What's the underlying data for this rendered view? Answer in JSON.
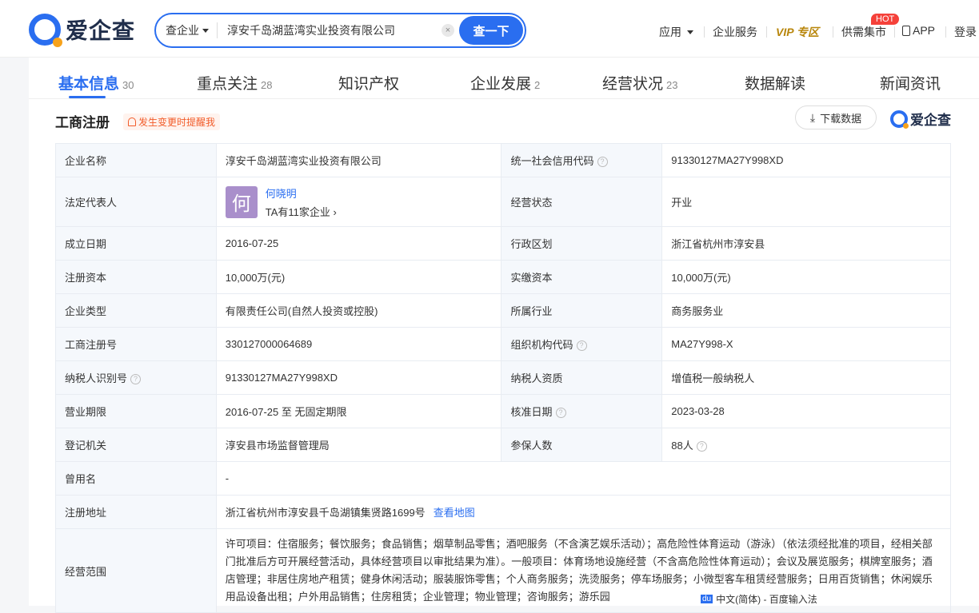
{
  "header": {
    "logo_text": "爱企查",
    "search_type": "查企业",
    "search_value": "淳安千岛湖蓝湾实业投资有限公司",
    "search_button": "查一下",
    "nav": {
      "app": "应用",
      "enterprise_service": "企业服务",
      "vip": "VIP 专区",
      "supply": "供需集市",
      "hot_badge": "HOT",
      "app_download": "APP",
      "login": "登录"
    }
  },
  "tabs": [
    {
      "label": "基本信息",
      "count": "30"
    },
    {
      "label": "重点关注",
      "count": "28"
    },
    {
      "label": "知识产权",
      "count": ""
    },
    {
      "label": "企业发展",
      "count": "2"
    },
    {
      "label": "经营状况",
      "count": "23"
    },
    {
      "label": "数据解读",
      "count": ""
    },
    {
      "label": "新闻资讯",
      "count": ""
    }
  ],
  "section": {
    "title": "工商注册",
    "remind": "发生变更时提醒我",
    "download": "下载数据",
    "brand": "爱企查"
  },
  "info": {
    "company_name_label": "企业名称",
    "company_name": "淳安千岛湖蓝湾实业投资有限公司",
    "credit_code_label": "统一社会信用代码",
    "credit_code": "91330127MA27Y998XD",
    "legal_rep_label": "法定代表人",
    "legal_rep_avatar": "何",
    "legal_rep_name": "何晓明",
    "legal_rep_sub": "TA有11家企业",
    "status_label": "经营状态",
    "status": "开业",
    "found_date_label": "成立日期",
    "found_date": "2016-07-25",
    "region_label": "行政区划",
    "region": "浙江省杭州市淳安县",
    "reg_capital_label": "注册资本",
    "reg_capital": "10,000万(元)",
    "paid_capital_label": "实缴资本",
    "paid_capital": "10,000万(元)",
    "type_label": "企业类型",
    "type": "有限责任公司(自然人投资或控股)",
    "industry_label": "所属行业",
    "industry": "商务服务业",
    "reg_no_label": "工商注册号",
    "reg_no": "330127000064689",
    "org_code_label": "组织机构代码",
    "org_code": "MA27Y998-X",
    "tax_id_label": "纳税人识别号",
    "tax_id": "91330127MA27Y998XD",
    "tax_qual_label": "纳税人资质",
    "tax_qual": "增值税一般纳税人",
    "period_label": "营业期限",
    "period": "2016-07-25 至 无固定期限",
    "approve_date_label": "核准日期",
    "approve_date": "2023-03-28",
    "authority_label": "登记机关",
    "authority": "淳安县市场监督管理局",
    "insured_label": "参保人数",
    "insured": "88人",
    "former_name_label": "曾用名",
    "former_name": "-",
    "address_label": "注册地址",
    "address": "浙江省杭州市淳安县千岛湖镇集贤路1699号",
    "map_link": "查看地图",
    "scope_label": "经营范围",
    "scope": "许可项目：住宿服务；餐饮服务；食品销售；烟草制品零售；酒吧服务（不含演艺娱乐活动）；高危险性体育运动（游泳）（依法须经批准的项目，经相关部门批准后方可开展经营活动，具体经营项目以审批结果为准）。一般项目：体育场地设施经营（不含高危险性体育运动）；会议及展览服务；棋牌室服务；酒店管理；非居住房地产租赁；健身休闲活动；服装服饰零售；个人商务服务；洗烫服务；停车场服务；小微型客车租赁经营服务；日用百货销售；休闲娱乐用品设备出租；户外用品销售；住房租赁；企业管理；物业管理；咨询服务；游乐园"
  },
  "ime": {
    "icon": "du",
    "text": "中文(简体) - 百度输入法"
  }
}
